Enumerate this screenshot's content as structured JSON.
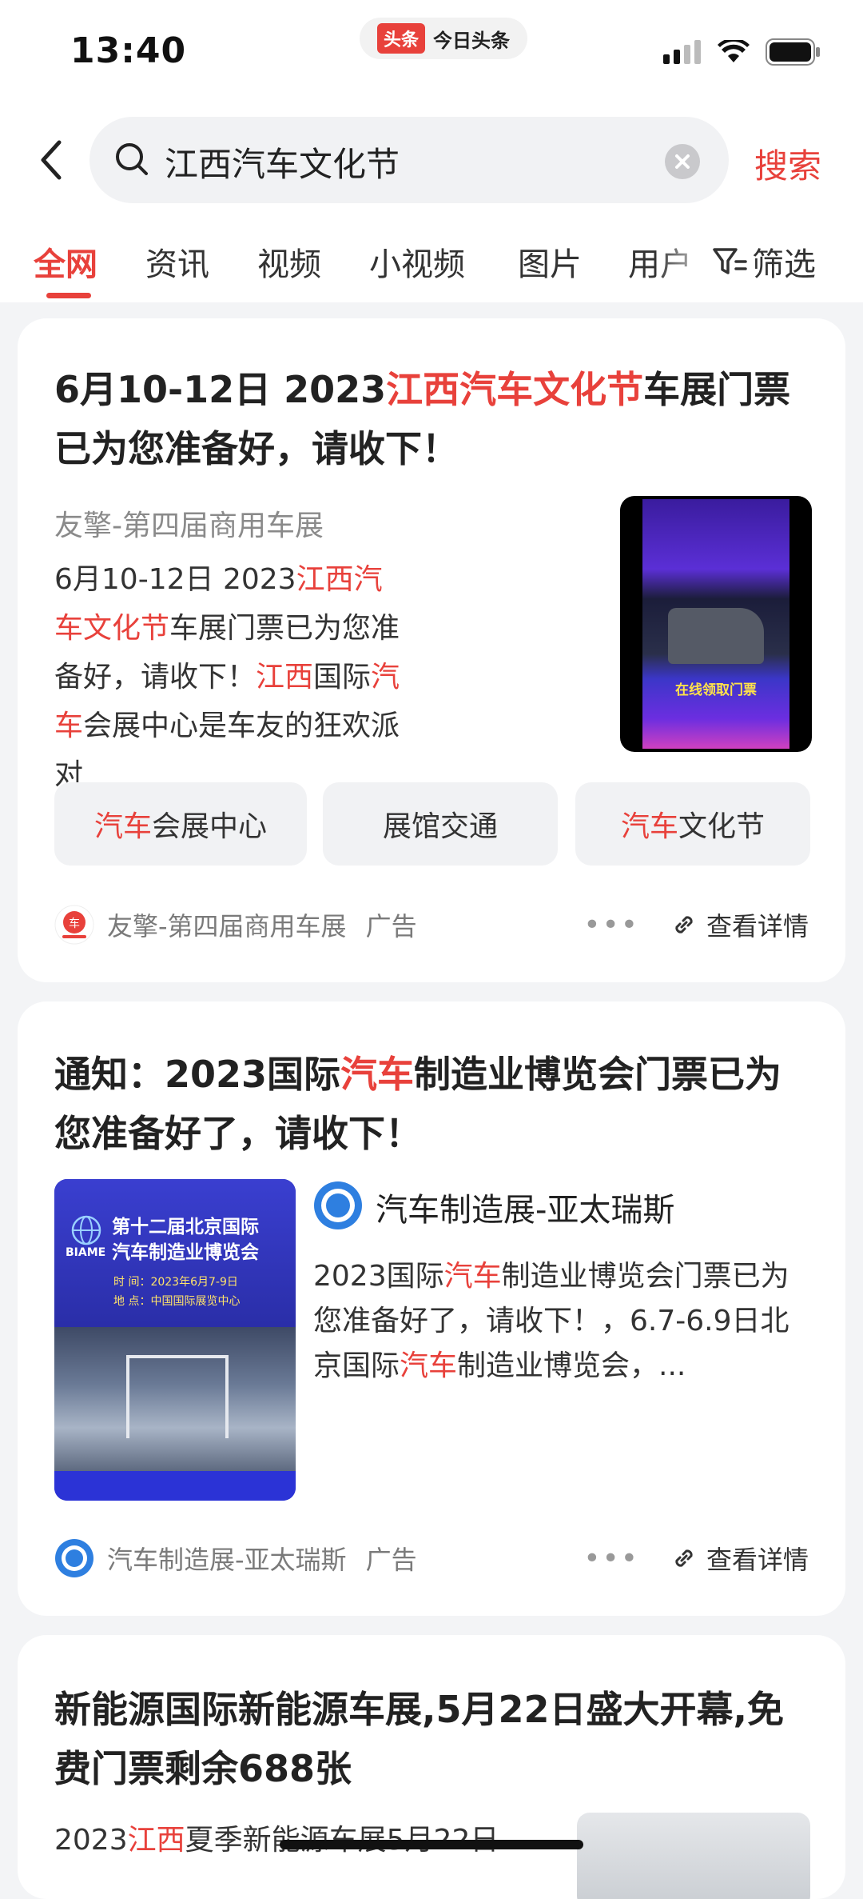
{
  "status_bar": {
    "time": "13:40",
    "app_logo": "头条",
    "app_name": "今日头条"
  },
  "search": {
    "query": "江西汽车文化节",
    "button_label": "搜索"
  },
  "tabs": [
    {
      "label": "全网",
      "active": true
    },
    {
      "label": "资讯"
    },
    {
      "label": "视频"
    },
    {
      "label": "小视频"
    },
    {
      "label": "图片"
    },
    {
      "label": "用户"
    }
  ],
  "filter_label": "筛选",
  "card1": {
    "title_pre": "6月10-12日 2023",
    "title_hl": "江西汽车文化节",
    "title_post": "车展门票已为您准备好，请收下！",
    "source": "友擎-第四届商用车展",
    "body_1": "6月10-12日 2023",
    "body_hl1": "江西汽车文化节",
    "body_2": "车展门票已为您准备好，请收下！",
    "body_hl2": "江西",
    "body_3": "国际",
    "body_hl3": "汽车",
    "body_4": "会展中心是车友的狂欢派对",
    "thumb_banner": "在线领取门票",
    "chips": [
      {
        "hl": "汽车",
        "text": "会展中心"
      },
      {
        "hl": "",
        "text": "展馆交通"
      },
      {
        "hl": "汽车",
        "text": "文化节"
      }
    ],
    "footer_source": "友擎-第四届商用车展",
    "ad_label": "广告",
    "detail_label": "查看详情"
  },
  "card2": {
    "title_pre": "通知：2023国际",
    "title_hl": "汽车",
    "title_post": "制造业博览会门票已为您准备好了，请收下！",
    "image_line1": "第十二届北京国际",
    "image_line2": "汽车制造业博览会",
    "image_time": "时  间：2023年6月7-9日",
    "image_place": "地  点：中国国际展览中心",
    "image_logo": "BIAME",
    "source": "汽车制造展-亚太瑞斯",
    "body_1": "2023国际",
    "body_hl1": "汽车",
    "body_2": "制造业博览会门票已为您准备好了，请收下！，6.7-6.9日北京国际",
    "body_hl2": "汽车",
    "body_3": "制造业博览会，...",
    "footer_source": "汽车制造展-亚太瑞斯",
    "ad_label": "广告",
    "detail_label": "查看详情"
  },
  "card3": {
    "title": "新能源国际新能源车展,5月22日盛大开幕,免费门票剩余688张",
    "body_1": "2023",
    "body_hl1": "江西",
    "body_2": "夏季新能源车展5月22日"
  }
}
